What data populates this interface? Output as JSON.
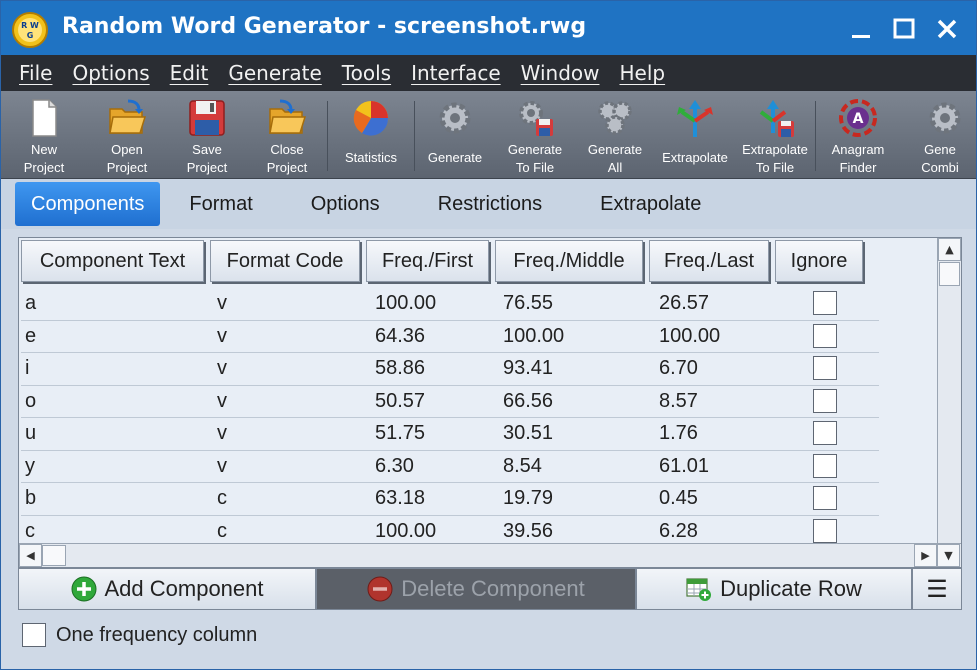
{
  "window": {
    "title": "Random Word Generator - screenshot.rwg",
    "logo_text": "RWG"
  },
  "menu": [
    "File",
    "Options",
    "Edit",
    "Generate",
    "Tools",
    "Interface",
    "Window",
    "Help"
  ],
  "toolbar": [
    {
      "label": "New\nProject",
      "icon": "new-project-icon"
    },
    {
      "label": "Open\nProject",
      "icon": "open-project-icon"
    },
    {
      "label": "Save\nProject",
      "icon": "save-project-icon"
    },
    {
      "label": "Close\nProject",
      "icon": "close-project-icon"
    },
    {
      "label": "Statistics",
      "icon": "statistics-icon"
    },
    {
      "label": "Generate",
      "icon": "generate-icon"
    },
    {
      "label": "Generate\nTo File",
      "icon": "generate-to-file-icon"
    },
    {
      "label": "Generate\nAll",
      "icon": "generate-all-icon"
    },
    {
      "label": "Extrapolate",
      "icon": "extrapolate-icon"
    },
    {
      "label": "Extrapolate\nTo File",
      "icon": "extrapolate-to-file-icon"
    },
    {
      "label": "Anagram\nFinder",
      "icon": "anagram-finder-icon"
    },
    {
      "label": "Gene\nCombi",
      "icon": "generate-combinations-icon"
    }
  ],
  "tabs": [
    "Components",
    "Format",
    "Options",
    "Restrictions",
    "Extrapolate"
  ],
  "active_tab": "Components",
  "grid": {
    "columns": [
      "Component Text",
      "Format Code",
      "Freq./First",
      "Freq./Middle",
      "Freq./Last",
      "Ignore"
    ],
    "rows": [
      [
        "a",
        "v",
        "100.00",
        "76.55",
        "26.57"
      ],
      [
        "e",
        "v",
        "64.36",
        "100.00",
        "100.00"
      ],
      [
        "i",
        "v",
        "58.86",
        "93.41",
        "6.70"
      ],
      [
        "o",
        "v",
        "50.57",
        "66.56",
        "8.57"
      ],
      [
        "u",
        "v",
        "51.75",
        "30.51",
        "1.76"
      ],
      [
        "y",
        "v",
        "6.30",
        "8.54",
        "61.01"
      ],
      [
        "b",
        "c",
        "63.18",
        "19.79",
        "0.45"
      ],
      [
        "c",
        "c",
        "100.00",
        "39.56",
        "6.28"
      ]
    ]
  },
  "buttons": {
    "add": "Add Component",
    "delete": "Delete Component",
    "duplicate": "Duplicate Row",
    "menu_glyph": "☰"
  },
  "option": {
    "label": "One frequency column"
  },
  "colors": {
    "titlebar": "#1f73c3",
    "menubar": "#2a2d33",
    "active_tab": "#2a80e0",
    "panel": "#cfd9e6"
  }
}
